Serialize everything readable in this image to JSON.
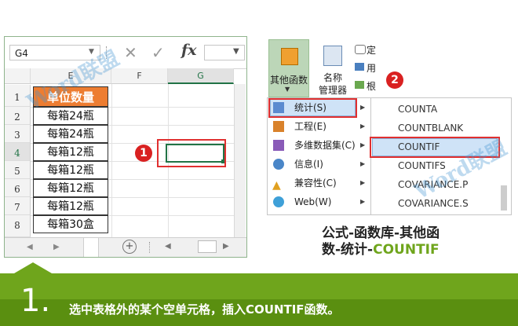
{
  "excel": {
    "name_box": "G4",
    "columns": [
      "E",
      "F",
      "G"
    ],
    "rows": [
      "1",
      "2",
      "3",
      "4",
      "5",
      "6",
      "7",
      "8"
    ],
    "header_cell": "单位数量",
    "values": [
      "每箱24瓶",
      "每箱24瓶",
      "每箱12瓶",
      "每箱12瓶",
      "每箱12瓶",
      "每箱12瓶",
      "每箱30盒"
    ]
  },
  "badges": {
    "one": "1",
    "two": "2"
  },
  "watermark": "Word联盟",
  "ribbon": {
    "other_functions": "其他函数",
    "name_manager_line1": "名称",
    "name_manager_line2": "管理器",
    "small1": "定",
    "small2": "用",
    "small3": "根"
  },
  "menu": {
    "items": [
      {
        "label": "统计(S)",
        "icon": "statistics-icon"
      },
      {
        "label": "工程(E)",
        "icon": "engineering-icon"
      },
      {
        "label": "多维数据集(C)",
        "icon": "cube-icon"
      },
      {
        "label": "信息(I)",
        "icon": "info-icon"
      },
      {
        "label": "兼容性(C)",
        "icon": "compatibility-icon"
      },
      {
        "label": "Web(W)",
        "icon": "web-icon"
      }
    ]
  },
  "submenu": {
    "items": [
      "COUNTA",
      "COUNTBLANK",
      "COUNTIF",
      "COUNTIFS",
      "COVARIANCE.P",
      "COVARIANCE.S"
    ]
  },
  "caption": {
    "line1": "公式-函数库-其他函",
    "line2_a": "数-统计-",
    "line2_b": "COUNTIF"
  },
  "banner": {
    "step": "1.",
    "text": "选中表格外的某个空单元格，插入COUNTIF函数。"
  },
  "colors": {
    "accent_orange": "#ed7d31",
    "highlight_red": "#e03030",
    "banner_green": "#6fa51c"
  }
}
